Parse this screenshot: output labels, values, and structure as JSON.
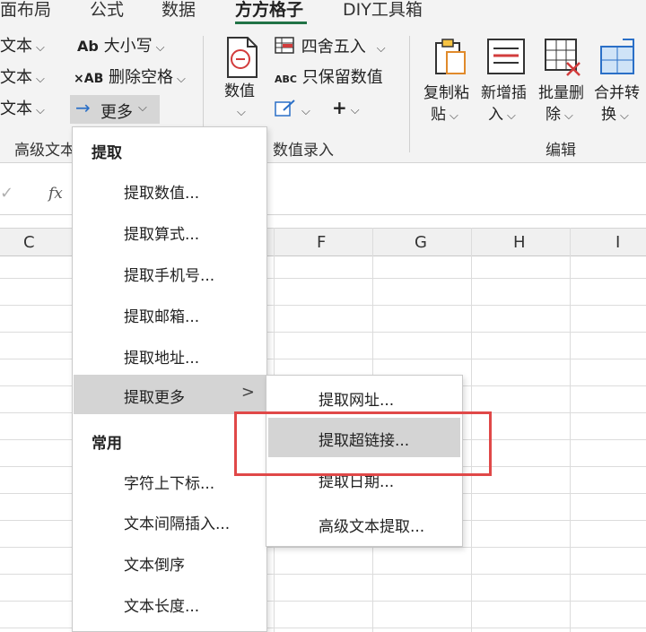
{
  "ribbon": {
    "tabs": [
      {
        "label": "面布局"
      },
      {
        "label": "公式"
      },
      {
        "label": "数据"
      },
      {
        "label": "方方格子"
      },
      {
        "label": "DIY工具箱"
      }
    ],
    "left_text_items": [
      "文本",
      "文本",
      "文本"
    ],
    "text_group": {
      "case_icon": "Ab",
      "case_label": "大小写",
      "delete_space_icon": "×AB",
      "delete_space_label": "删除空格",
      "more_label": "更多",
      "group_label": "高级文本"
    },
    "numeric_group": {
      "value_button_label": "数值",
      "round_label": "四舍五入",
      "keep_numeric_icon": "ABC",
      "keep_numeric_label": "只保留数值",
      "plus_label": "+",
      "group_label": "数值录入"
    },
    "edit_group": {
      "copy_paste_label": "复制粘贴",
      "insert_label": "新增插入",
      "batch_delete_label": "批量删除",
      "merge_label": "合并转换",
      "group_label": "编辑"
    }
  },
  "formula_bar": {
    "fx_label": "fx"
  },
  "columns": [
    "C",
    "F",
    "G",
    "H",
    "I"
  ],
  "menu": {
    "section_extract": "提取",
    "items_extract": [
      {
        "label": "提取数值..."
      },
      {
        "label": "提取算式..."
      },
      {
        "label": "提取手机号..."
      },
      {
        "label": "提取邮箱..."
      },
      {
        "label": "提取地址..."
      },
      {
        "label": "提取更多"
      }
    ],
    "section_common": "常用",
    "items_common": [
      {
        "label": "字符上下标..."
      },
      {
        "label": "文本间隔插入..."
      },
      {
        "label": "文本倒序"
      },
      {
        "label": "文本长度..."
      }
    ]
  },
  "submenu": {
    "items": [
      {
        "label": "提取网址..."
      },
      {
        "label": "提取超链接..."
      },
      {
        "label": "提取日期..."
      },
      {
        "label": "高级文本提取..."
      }
    ]
  },
  "colors": {
    "accent": "#217346",
    "highlight": "#d4d4d4",
    "annotation": "#e04848"
  }
}
